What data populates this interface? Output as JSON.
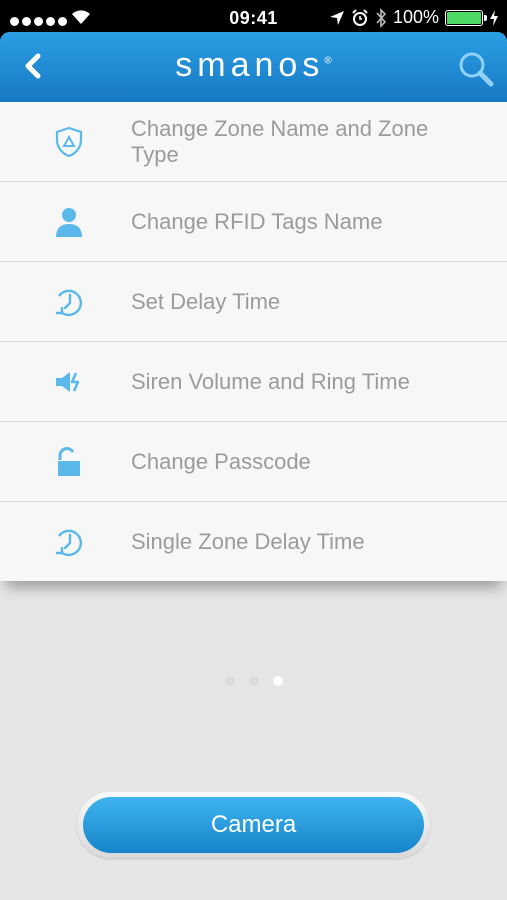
{
  "status_bar": {
    "time": "09:41",
    "battery": "100%"
  },
  "header": {
    "logo": "smanos",
    "logo_mark": "®"
  },
  "menu": [
    {
      "label": "Change Zone Name and Zone Type",
      "icon": "shield-icon"
    },
    {
      "label": "Change RFID Tags Name",
      "icon": "user-icon"
    },
    {
      "label": "Set Delay Time",
      "icon": "clock-icon"
    },
    {
      "label": "Siren Volume and Ring Time",
      "icon": "speaker-icon"
    },
    {
      "label": "Change Passcode",
      "icon": "unlock-icon"
    },
    {
      "label": "Single Zone Delay Time",
      "icon": "clock-icon"
    }
  ],
  "pager": {
    "count": 3,
    "active": 3
  },
  "camera_button": "Camera",
  "colors": {
    "accent": "#2a9ee4",
    "icon": "#5bb8ea",
    "label": "#9b9b9b"
  }
}
